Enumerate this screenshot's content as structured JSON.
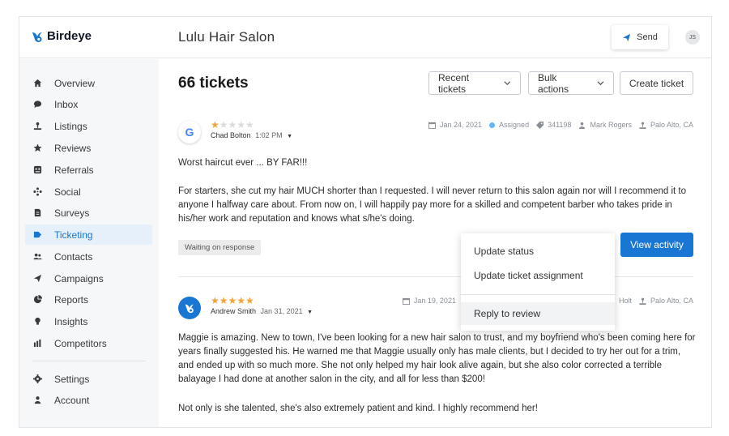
{
  "header": {
    "brand": "Birdeye",
    "business_name": "Lulu Hair Salon",
    "send_label": "Send",
    "avatar_initials": "JS"
  },
  "sidebar": {
    "items": [
      {
        "label": "Overview",
        "icon": "home-icon"
      },
      {
        "label": "Inbox",
        "icon": "chat-bubble-icon"
      },
      {
        "label": "Listings",
        "icon": "map-pin-icon"
      },
      {
        "label": "Reviews",
        "icon": "star-icon"
      },
      {
        "label": "Referrals",
        "icon": "referral-icon"
      },
      {
        "label": "Social",
        "icon": "social-icon"
      },
      {
        "label": "Surveys",
        "icon": "survey-icon"
      },
      {
        "label": "Ticketing",
        "icon": "ticket-icon",
        "active": true
      },
      {
        "label": "Contacts",
        "icon": "contacts-icon"
      },
      {
        "label": "Campaigns",
        "icon": "send-icon"
      },
      {
        "label": "Reports",
        "icon": "pie-chart-icon"
      },
      {
        "label": "Insights",
        "icon": "bulb-icon"
      },
      {
        "label": "Competitors",
        "icon": "bar-chart-icon"
      }
    ],
    "bottom_items": [
      {
        "label": "Settings",
        "icon": "gear-icon"
      },
      {
        "label": "Account",
        "icon": "person-icon"
      }
    ]
  },
  "main": {
    "title": "66 tickets",
    "recent_tickets_label": "Recent tickets",
    "bulk_actions_label": "Bulk actions",
    "create_ticket_label": "Create ticket",
    "view_activity_label": "View activity"
  },
  "reviews": [
    {
      "source": "G",
      "rating": 1,
      "reviewer": "Chad Bolton",
      "time": "1:02 PM",
      "date": "Jan 24, 2021",
      "status": "Assigned",
      "ticket_id": "341198",
      "assignee": "Mark Rogers",
      "location": "Palo Alto, CA",
      "headline": "Worst haircut ever ... BY FAR!!!",
      "body": "For starters, she cut my hair MUCH shorter than I requested. I will never return to this salon again nor will I recommend it to anyone I halfway care about. From now on, I will happily pay more for a skilled and competent barber who takes pride in his/her work and reputation and knows what s/he's doing.",
      "ticket_status": "Waiting on response"
    },
    {
      "source": "birdeye",
      "rating": 5,
      "reviewer": "Andrew Smith",
      "time": "Jan 31, 2021",
      "date": "Jan 19, 2021",
      "assignee_partial": "Holt",
      "location": "Palo Alto, CA",
      "body": "Maggie is amazing. New to town, I've been looking for a new hair salon to trust, and my boyfriend who's been coming here for years finally suggested his. He warned me that Maggie usually only has male clients, but I decided to try her out for a trim, and ended up with so much more. She not only helped my hair look alive again, but she also color corrected a terrible balayage I had done at another salon in the city, and all for less than $200!",
      "body2": "Not only is she talented, she's also extremely patient and kind. I highly recommend her!"
    }
  ],
  "menu": {
    "items": [
      "Update status",
      "Update ticket assignment",
      "Reply to review"
    ]
  },
  "colors": {
    "accent": "#1976d2",
    "star": "#f2a33a",
    "sidebar_bg": "#f6f7f9"
  }
}
